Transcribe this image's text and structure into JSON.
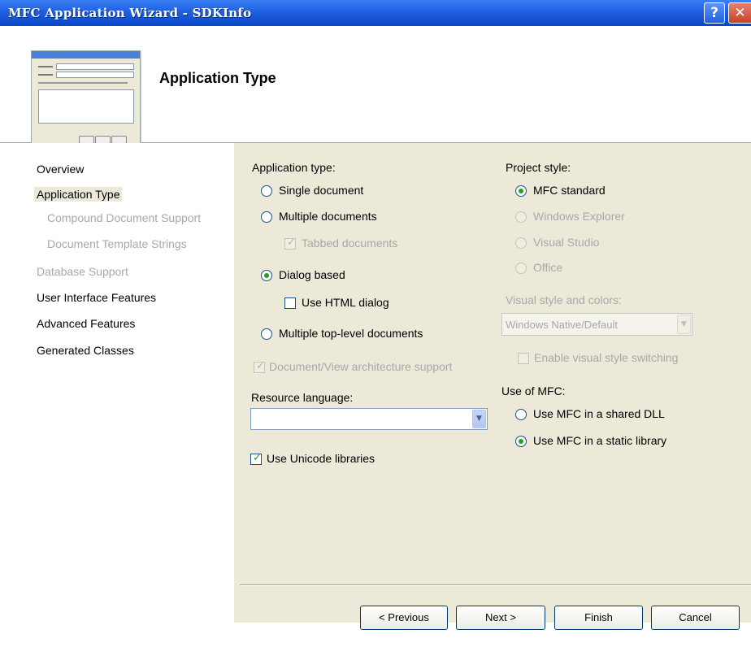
{
  "window": {
    "title": "MFC Application Wizard - SDKInfo",
    "help_glyph": "?",
    "close_glyph": "✕"
  },
  "header": {
    "title": "Application Type"
  },
  "nav": {
    "items": [
      {
        "label": "Overview"
      },
      {
        "label": "Application Type"
      },
      {
        "label": "Compound Document Support"
      },
      {
        "label": "Document Template Strings"
      },
      {
        "label": "Database Support"
      },
      {
        "label": "User Interface Features"
      },
      {
        "label": "Advanced Features"
      },
      {
        "label": "Generated Classes"
      }
    ]
  },
  "app_type": {
    "heading": "Application type:",
    "single": "Single document",
    "multiple": "Multiple documents",
    "tabbed": "Tabbed documents",
    "dialog": "Dialog based",
    "html_dialog": "Use HTML dialog",
    "toplevel": "Multiple top-level documents",
    "docview": "Document/View architecture support"
  },
  "resource": {
    "heading": "Resource language:",
    "value": ""
  },
  "unicode": "Use Unicode libraries",
  "project_style": {
    "heading": "Project style:",
    "mfc_standard": "MFC standard",
    "explorer": "Windows Explorer",
    "visual_studio": "Visual Studio",
    "office": "Office"
  },
  "visual_style": {
    "heading": "Visual style and colors:",
    "value": "Windows Native/Default",
    "switching": "Enable visual style switching"
  },
  "mfc_use": {
    "heading": "Use of MFC:",
    "shared": "Use MFC in a shared DLL",
    "static": "Use MFC in a static library"
  },
  "buttons": {
    "previous": "< Previous",
    "next": "Next >",
    "finish": "Finish",
    "cancel": "Cancel"
  }
}
